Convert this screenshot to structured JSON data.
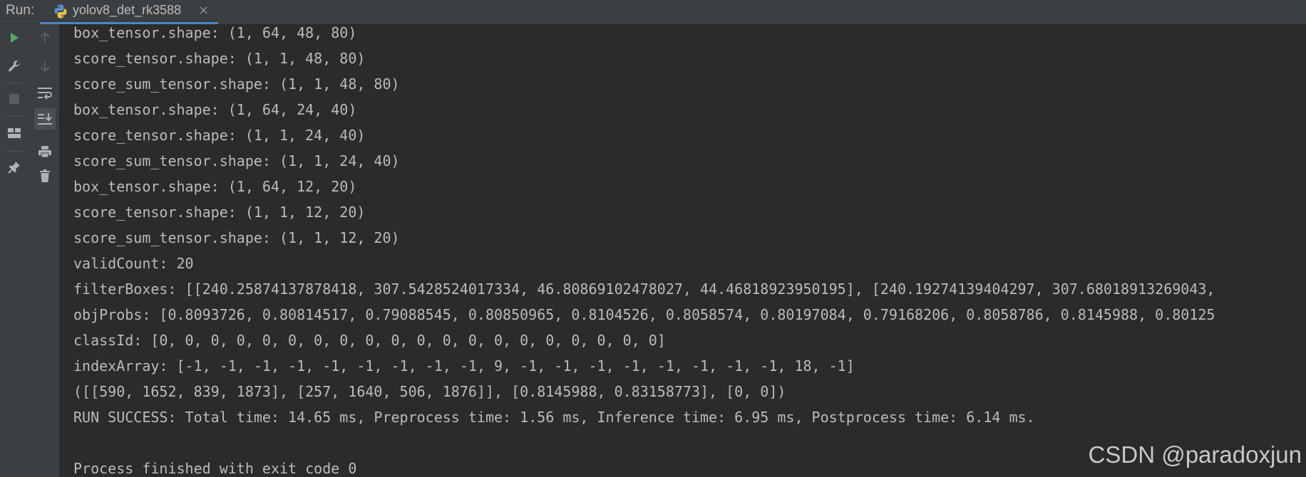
{
  "run_panel": {
    "label": "Run:",
    "tab": {
      "title": "yolov8_det_rk3588",
      "close_glyph": "×",
      "icon": "python-icon"
    }
  },
  "toolbar_outer": [
    {
      "name": "run-icon",
      "color": "#59a869"
    },
    {
      "name": "wrench-icon",
      "color": "#afb1b3"
    },
    {
      "name": "stop-icon",
      "color": "#5a5d5f"
    },
    {
      "name": "layout-icon",
      "color": "#afb1b3"
    },
    {
      "name": "pin-icon",
      "color": "#afb1b3"
    }
  ],
  "toolbar_inner": [
    {
      "name": "up-arrow-icon",
      "color": "#5a5d5f"
    },
    {
      "name": "down-arrow-icon",
      "color": "#5a5d5f"
    },
    {
      "name": "soft-wrap-icon",
      "color": "#afb1b3"
    },
    {
      "name": "scroll-to-end-icon",
      "color": "#afb1b3",
      "active": true
    },
    {
      "name": "print-icon",
      "color": "#afb1b3"
    },
    {
      "name": "trash-icon",
      "color": "#afb1b3"
    }
  ],
  "console": {
    "lines": [
      "box_tensor.shape: (1, 64, 48, 80)",
      "score_tensor.shape: (1, 1, 48, 80)",
      "score_sum_tensor.shape: (1, 1, 48, 80)",
      "box_tensor.shape: (1, 64, 24, 40)",
      "score_tensor.shape: (1, 1, 24, 40)",
      "score_sum_tensor.shape: (1, 1, 24, 40)",
      "box_tensor.shape: (1, 64, 12, 20)",
      "score_tensor.shape: (1, 1, 12, 20)",
      "score_sum_tensor.shape: (1, 1, 12, 20)",
      "validCount: 20",
      "filterBoxes: [[240.25874137878418, 307.5428524017334, 46.80869102478027, 44.46818923950195], [240.19274139404297, 307.68018913269043,",
      "objProbs: [0.8093726, 0.80814517, 0.79088545, 0.80850965, 0.8104526, 0.8058574, 0.80197084, 0.79168206, 0.8058786, 0.8145988, 0.80125",
      "classId: [0, 0, 0, 0, 0, 0, 0, 0, 0, 0, 0, 0, 0, 0, 0, 0, 0, 0, 0, 0]",
      "indexArray: [-1, -1, -1, -1, -1, -1, -1, -1, -1, 9, -1, -1, -1, -1, -1, -1, -1, -1, 18, -1]",
      "([[590, 1652, 839, 1873], [257, 1640, 506, 1876]], [0.8145988, 0.83158773], [0, 0])",
      "RUN SUCCESS: Total time: 14.65 ms, Preprocess time: 1.56 ms, Inference time: 6.95 ms, Postprocess time: 6.14 ms.",
      "",
      "Process finished with exit code 0"
    ]
  },
  "watermark": "CSDN @paradoxjun"
}
